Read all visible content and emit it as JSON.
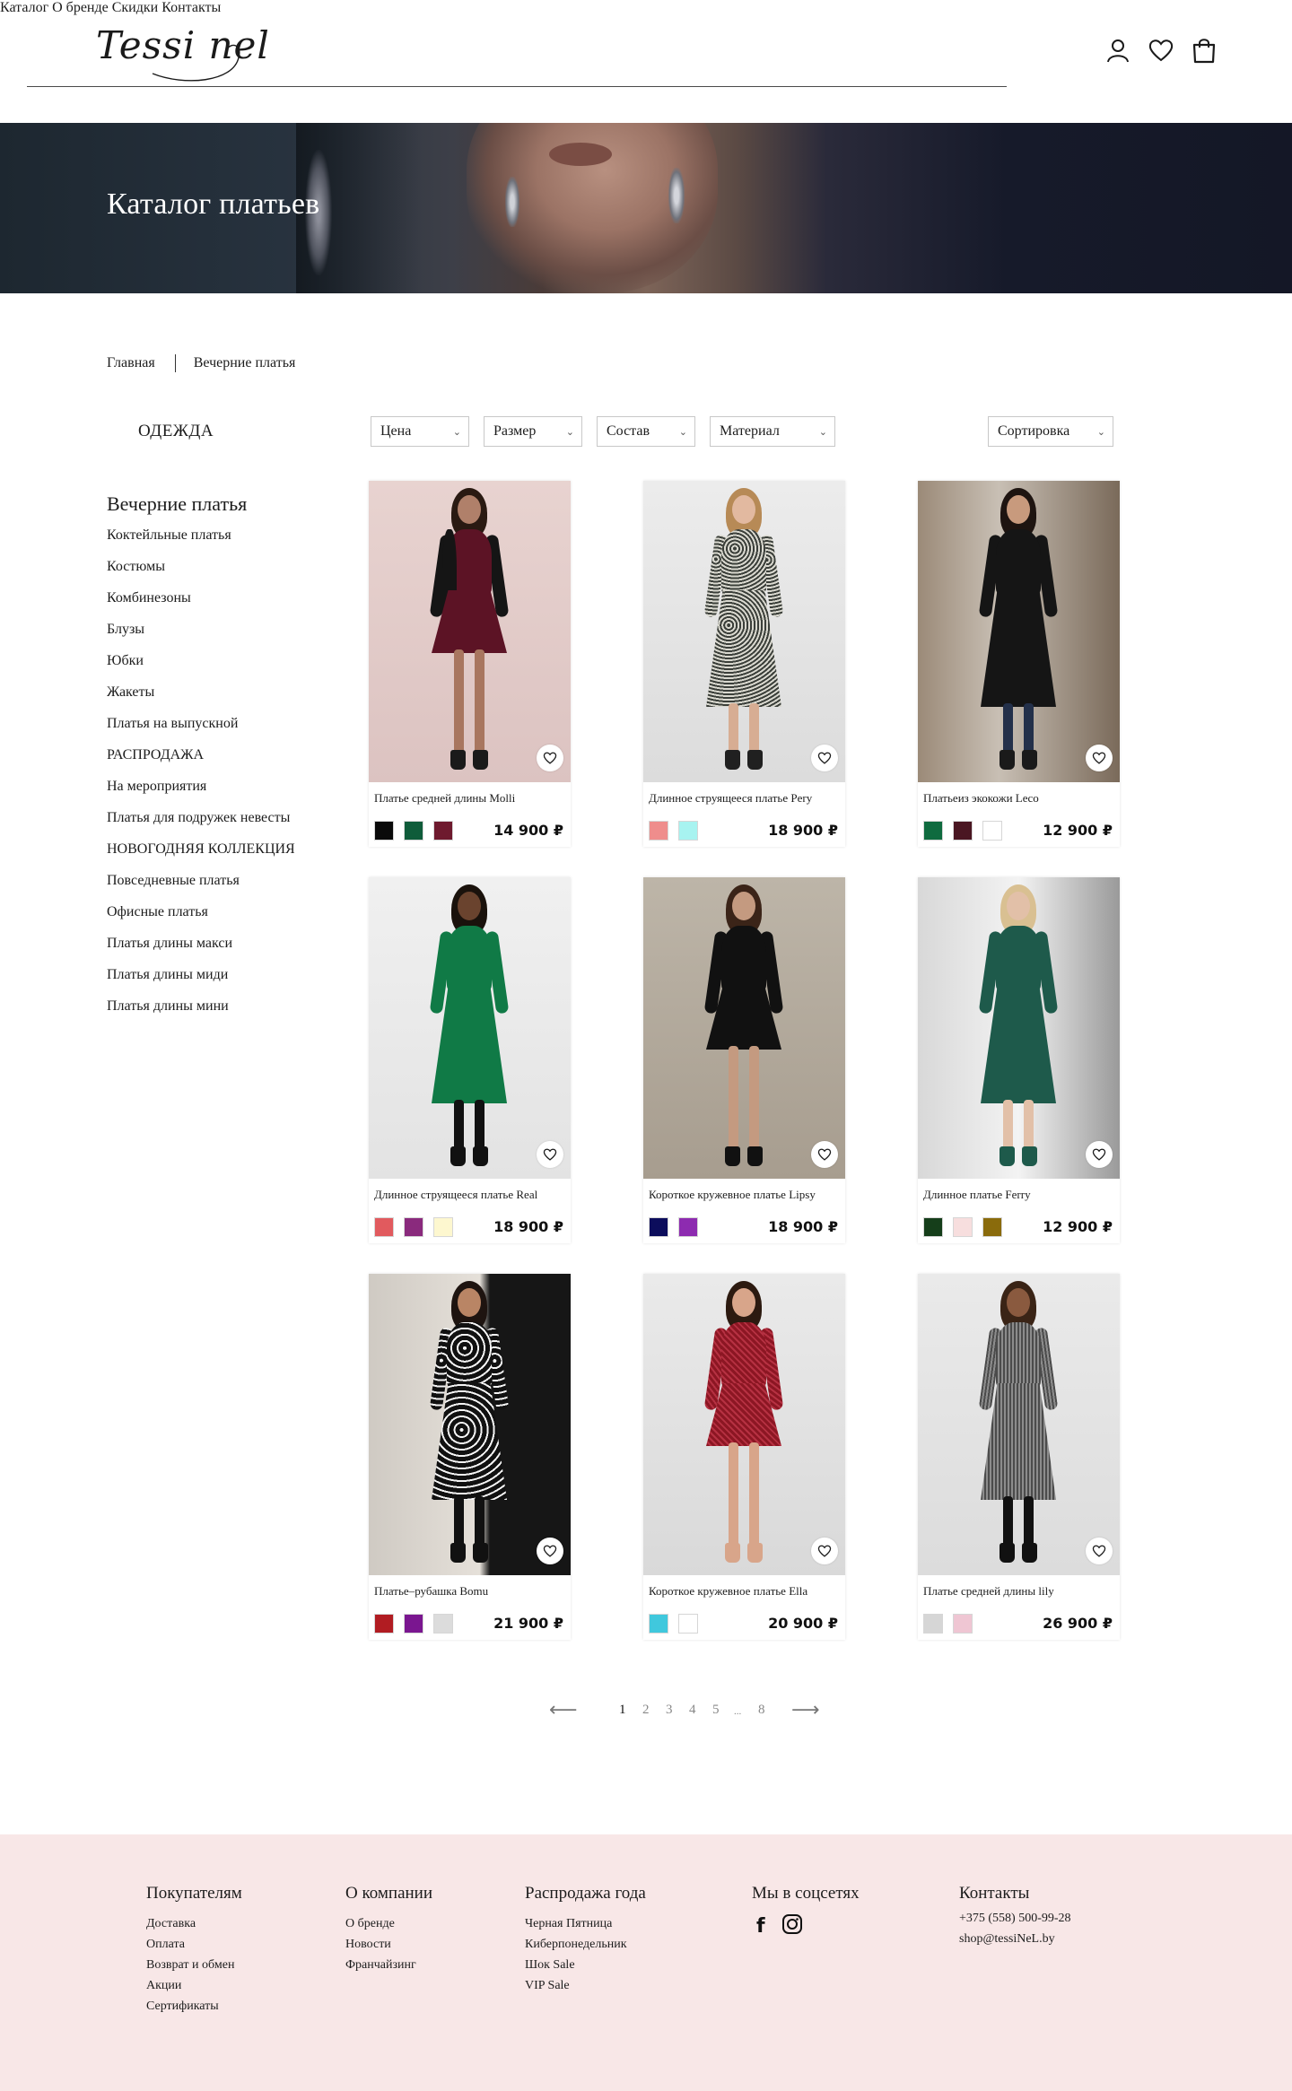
{
  "header": {
    "logo": "Tessi nel",
    "nav": [
      {
        "label": "Каталог"
      },
      {
        "label": "О бренде"
      },
      {
        "label": "Скидки"
      },
      {
        "label": "Контакты"
      }
    ],
    "icons": [
      "user-icon",
      "heart-icon",
      "bag-icon"
    ]
  },
  "hero": {
    "title": "Каталог платьев"
  },
  "breadcrumb": {
    "home": "Главная",
    "current": "Вечерние платья"
  },
  "sidebar": {
    "title": "ОДЕЖДА",
    "items": [
      "Вечерние платья",
      "Коктейльные платья",
      "Костюмы",
      "Комбинезоны",
      "Блузы",
      "Юбки",
      "Жакеты",
      "Платья на выпускной",
      "РАСПРОДАЖА",
      "На мероприятия",
      "Платья для подружек невесты",
      "НОВОГОДНЯЯ КОЛЛЕКЦИЯ",
      "Повседневные платья",
      "Офисные платья",
      "Платья длины макси",
      "Платья длины миди",
      "Платья длины мини"
    ]
  },
  "filters": {
    "price": "Цена",
    "size": "Размер",
    "composition": "Состав",
    "material": "Материал",
    "sort": "Сортировка"
  },
  "products": [
    {
      "name": "Платье средней длины Molli",
      "price": "14 900 ₽",
      "swatches": [
        "#0a0a0a",
        "#0f5c3a",
        "#6e1a2e"
      ]
    },
    {
      "name": "Длинное струящееся платье Pery",
      "price": "18 900 ₽",
      "swatches": [
        "#ef8d8c",
        "#a7f3f0"
      ]
    },
    {
      "name": "Платьеиз экокожи Leco",
      "price": "12 900 ₽",
      "swatches": [
        "#0f6b3f",
        "#4a1622",
        "#ffffff"
      ]
    },
    {
      "name": "Длинное струящееся платье Real",
      "price": "18 900 ₽",
      "swatches": [
        "#e15a5e",
        "#8a2a7d",
        "#fdf7cf"
      ]
    },
    {
      "name": "Короткое кружевное платье Lipsy",
      "price": "18 900 ₽",
      "swatches": [
        "#0c0d5c",
        "#8d2bb0"
      ]
    },
    {
      "name": "Длинное платье Ferry",
      "price": "12 900 ₽",
      "swatches": [
        "#153e1a",
        "#f7dede",
        "#8a6b0c"
      ]
    },
    {
      "name": "Платье–рубашка Bomu",
      "price": "21 900 ₽",
      "swatches": [
        "#b11c22",
        "#7a1690",
        "#dcdcdc"
      ]
    },
    {
      "name": "Короткое кружевное платье Ella",
      "price": "20 900 ₽",
      "swatches": [
        "#40c8dd",
        "#ffffff"
      ]
    },
    {
      "name": "Платье средней длины lily",
      "price": "26 900 ₽",
      "swatches": [
        "#d6d6d6",
        "#efc6d3"
      ]
    }
  ],
  "pagination": {
    "prev": "⟵",
    "pages": [
      "1",
      "2",
      "3",
      "4",
      "5",
      "...",
      "8"
    ],
    "current": "1",
    "next": "⟶"
  },
  "footer": {
    "buyers": {
      "title": "Покупателям",
      "links": [
        "Доставка",
        "Оплата",
        "Возврат и обмен",
        "Акции",
        "Сертификаты"
      ]
    },
    "company": {
      "title": "О компании",
      "links": [
        "О бренде",
        "Новости",
        "Франчайзинг"
      ]
    },
    "sale": {
      "title": "Распродажа года",
      "links": [
        "Черная Пятница",
        "Киберпонедельник",
        "Шок Sale",
        "VIP Sale"
      ]
    },
    "social": {
      "title": "Мы в соцсетях",
      "icons": [
        "facebook-icon",
        "instagram-icon"
      ]
    },
    "contacts": {
      "title": "Контакты",
      "phone": "+375 (558) 500-99-28",
      "email": "shop@tessiNeL.by"
    }
  },
  "brand_colors": {
    "footer_bg": "#f8e7e7",
    "hero_dark": "#1d2730",
    "text": "#1c1c1c"
  }
}
